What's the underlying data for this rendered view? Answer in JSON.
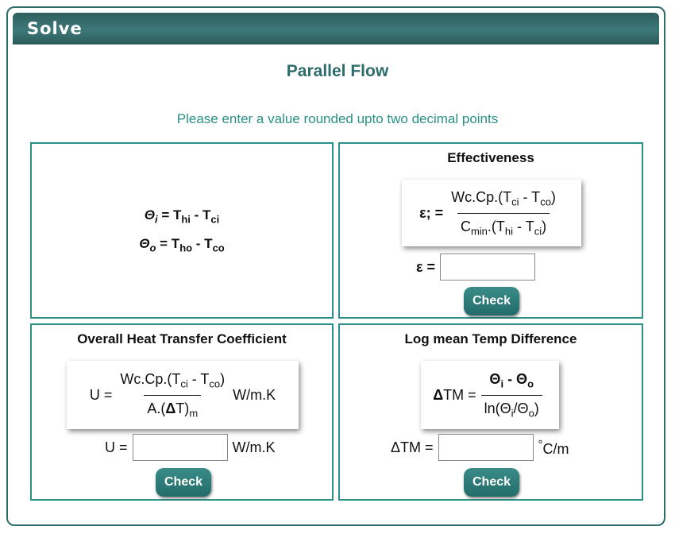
{
  "window": {
    "title": "Solve"
  },
  "heading": "Parallel Flow",
  "instruction": "Please enter a value rounded upto two decimal points",
  "definitions": {
    "theta_i": {
      "symbol": "Θ",
      "subscript": "i",
      "eq": " = T",
      "t1": "hi",
      "minus": " - T",
      "t2": "ci"
    },
    "theta_o": {
      "symbol": "Θ",
      "subscript": "o",
      "eq": " = T",
      "t1": "ho",
      "minus": " - T",
      "t2": "co"
    }
  },
  "effectiveness": {
    "title": "Effectiveness",
    "lhs": "ε; =",
    "num_a": "Wc.Cp.(T",
    "num_sub1": "ci",
    "num_b": " - T",
    "num_sub2": "co",
    "num_c": ")",
    "den_a": "C",
    "den_sub1": "min",
    "den_b": ".(T",
    "den_sub2": "hi",
    "den_c": " - T",
    "den_sub3": "ci",
    "den_d": ")",
    "input_label": "ε =",
    "input_value": "",
    "check_label": "Check"
  },
  "overall_u": {
    "title": "Overall Heat Transfer Coefficient",
    "lhs": "U =",
    "num_a": "Wc.Cp.(T",
    "num_sub1": "ci",
    "num_b": " - T",
    "num_sub2": "co",
    "num_c": ")",
    "den_a": "A.(",
    "den_delta": "Δ",
    "den_b": "T)",
    "den_sub": "m",
    "unit": "W/m.K",
    "input_label": "U =",
    "input_value": "",
    "input_unit": "W/m.K",
    "check_label": "Check"
  },
  "lmtd": {
    "title": "Log mean Temp Difference",
    "lhs_delta": "Δ",
    "lhs": "TM =",
    "num_a": "Θ",
    "num_sub1": "i",
    "num_b": " - Θ",
    "num_sub2": "o",
    "den_a": "ln(Θ",
    "den_sub1": "i",
    "den_b": "/Θ",
    "den_sub2": "o",
    "den_c": ")",
    "input_label": "ΔTM =",
    "input_value": "",
    "input_unit_deg": "°",
    "input_unit": "C/m",
    "check_label": "Check"
  },
  "colors": {
    "accent": "#2e6b6b",
    "panel_border": "#2a9088",
    "instruction": "#2a8f86"
  }
}
